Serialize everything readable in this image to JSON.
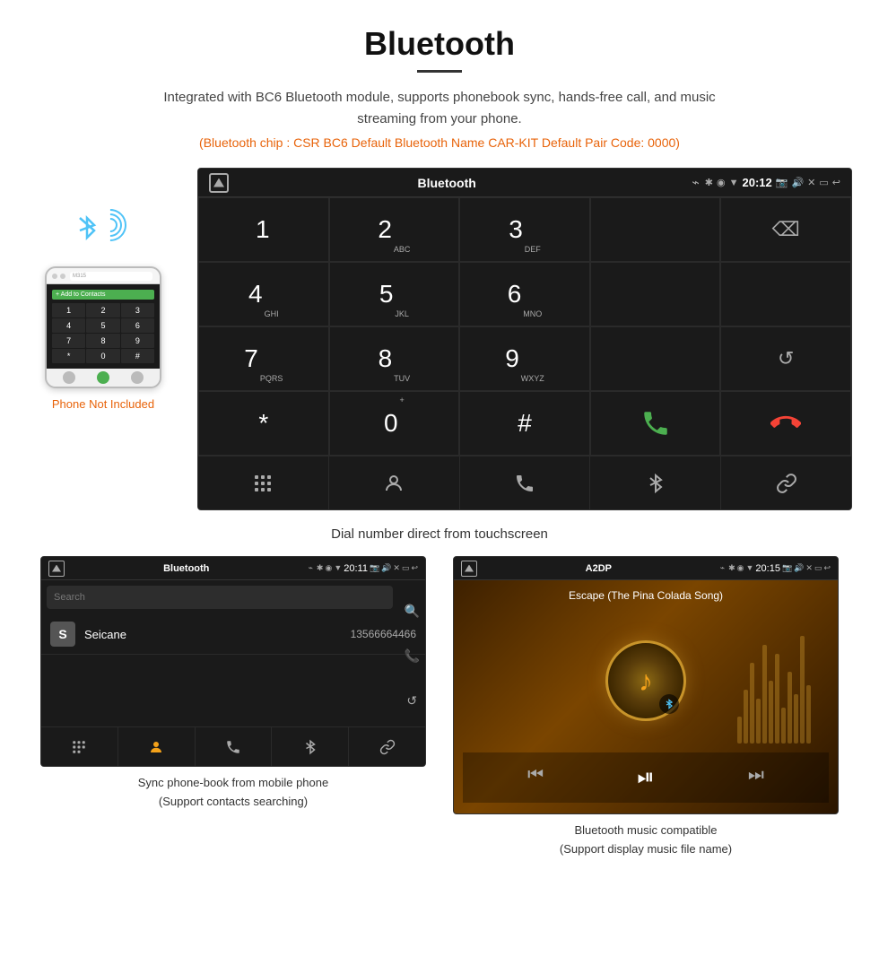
{
  "header": {
    "title": "Bluetooth",
    "subtitle": "Integrated with BC6 Bluetooth module, supports phonebook sync, hands-free call, and music streaming from your phone.",
    "specs": "(Bluetooth chip : CSR BC6    Default Bluetooth Name CAR-KIT    Default Pair Code: 0000)"
  },
  "phone_label": "Phone Not Included",
  "main_screen": {
    "status_bar": {
      "title": "Bluetooth",
      "usb": "⌁",
      "time": "20:12"
    },
    "dialpad": [
      {
        "number": "1",
        "sub": ""
      },
      {
        "number": "2",
        "sub": "ABC"
      },
      {
        "number": "3",
        "sub": "DEF"
      },
      {
        "number": "",
        "sub": ""
      },
      {
        "number": "⌫",
        "sub": ""
      },
      {
        "number": "4",
        "sub": "GHI"
      },
      {
        "number": "5",
        "sub": "JKL"
      },
      {
        "number": "6",
        "sub": "MNO"
      },
      {
        "number": "",
        "sub": ""
      },
      {
        "number": "",
        "sub": ""
      },
      {
        "number": "7",
        "sub": "PQRS"
      },
      {
        "number": "8",
        "sub": "TUV"
      },
      {
        "number": "9",
        "sub": "WXYZ"
      },
      {
        "number": "",
        "sub": ""
      },
      {
        "number": "↺",
        "sub": ""
      },
      {
        "number": "★",
        "sub": ""
      },
      {
        "number": "0",
        "sub": "+"
      },
      {
        "number": "#",
        "sub": ""
      },
      {
        "number": "📞",
        "sub": ""
      },
      {
        "number": "📵",
        "sub": ""
      }
    ],
    "toolbar": [
      "⊞",
      "👤",
      "📞",
      "✱",
      "🔗"
    ]
  },
  "main_caption": "Dial number direct from touchscreen",
  "pb_screen": {
    "status": {
      "title": "Bluetooth",
      "time": "20:11"
    },
    "search_placeholder": "Search",
    "contacts": [
      {
        "initial": "S",
        "name": "Seicane",
        "number": "13566664466"
      }
    ]
  },
  "music_screen": {
    "status": {
      "title": "A2DP",
      "time": "20:15"
    },
    "song_title": "Escape (The Pina Colada Song)"
  },
  "pb_caption": "Sync phone-book from mobile phone\n(Support contacts searching)",
  "music_caption": "Bluetooth music compatible\n(Support display music file name)",
  "phone_keypad": [
    "1",
    "2",
    "3",
    "4",
    "5",
    "6",
    "7",
    "8",
    "9",
    "*",
    "0",
    "#"
  ]
}
